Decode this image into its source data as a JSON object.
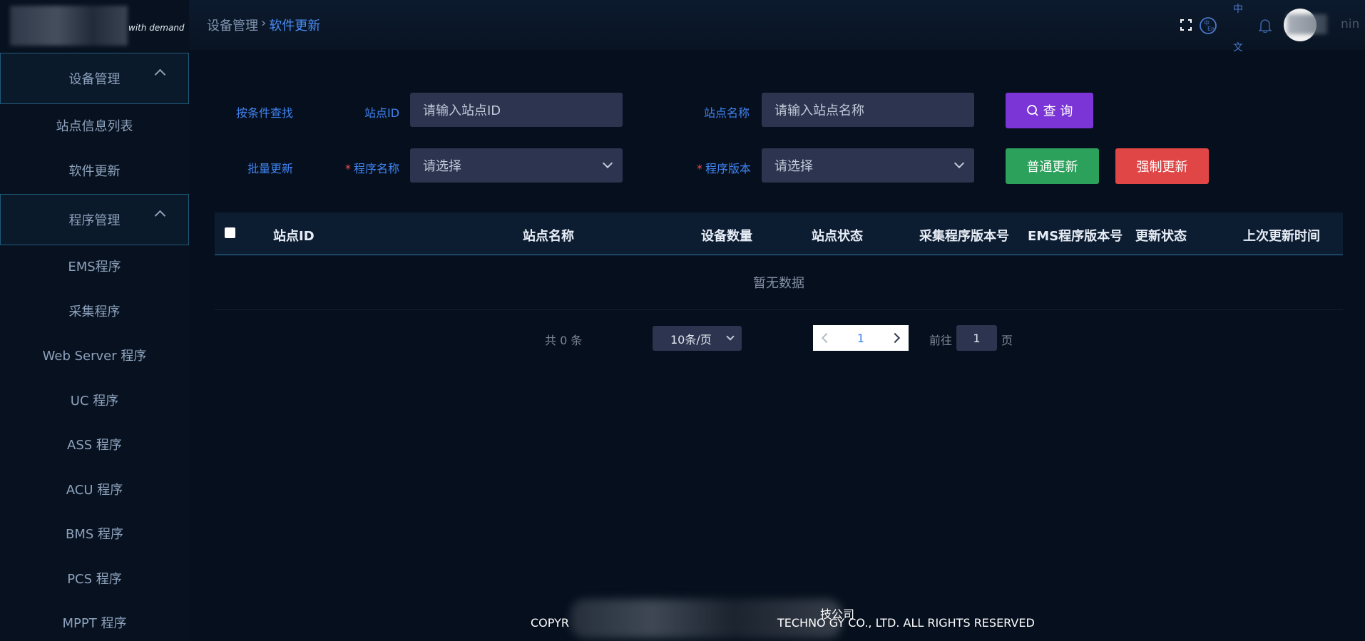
{
  "header": {
    "breadcrumb": [
      "设备管理",
      "软件更新"
    ],
    "lang_top": "中",
    "lang_bottom": "文",
    "user_text_tail": "nin"
  },
  "logo": {
    "slogan": "with demand"
  },
  "sidebar": {
    "groups": [
      {
        "label": "设备管理",
        "items": [
          "站点信息列表",
          "软件更新"
        ]
      },
      {
        "label": "程序管理",
        "items": [
          "EMS程序",
          "采集程序",
          "Web Server 程序",
          "UC 程序",
          "ASS 程序",
          "ACU 程序",
          "BMS 程序",
          "PCS 程序",
          "MPPT 程序"
        ]
      }
    ]
  },
  "search": {
    "section_label": "按条件查找",
    "site_id_label": "站点ID",
    "site_id_placeholder": "请输入站点ID",
    "site_name_label": "站点名称",
    "site_name_placeholder": "请输入站点名称",
    "query_button": "查 询"
  },
  "batch": {
    "section_label": "批量更新",
    "program_name_label": "程序名称",
    "program_name_value": "请选择",
    "program_version_label": "程序版本",
    "program_version_value": "请选择",
    "normal_update": "普通更新",
    "force_update": "强制更新",
    "required_mark": "*"
  },
  "table": {
    "columns": [
      "站点ID",
      "站点名称",
      "设备数量",
      "站点状态",
      "采集程序版本号",
      "EMS程序版本号",
      "更新状态",
      "上次更新时间"
    ],
    "empty_text": "暂无数据"
  },
  "pagination": {
    "total_text": "共 0 条",
    "page_size": "10条/页",
    "current_page": "1",
    "goto_prefix": "前往",
    "goto_value": "1",
    "goto_suffix": "页"
  },
  "footer": {
    "line1_tail": "技公司",
    "line2_start": "COPYR",
    "line2_end": "TECHNO   GY CO., LTD. ALL RIGHTS RESERVED"
  },
  "colors": {
    "accent_blue": "#3f83f0",
    "query_button": "#7b35d6",
    "normal_update": "#2ba15b",
    "force_update": "#e04646",
    "background": "#060f1d"
  }
}
